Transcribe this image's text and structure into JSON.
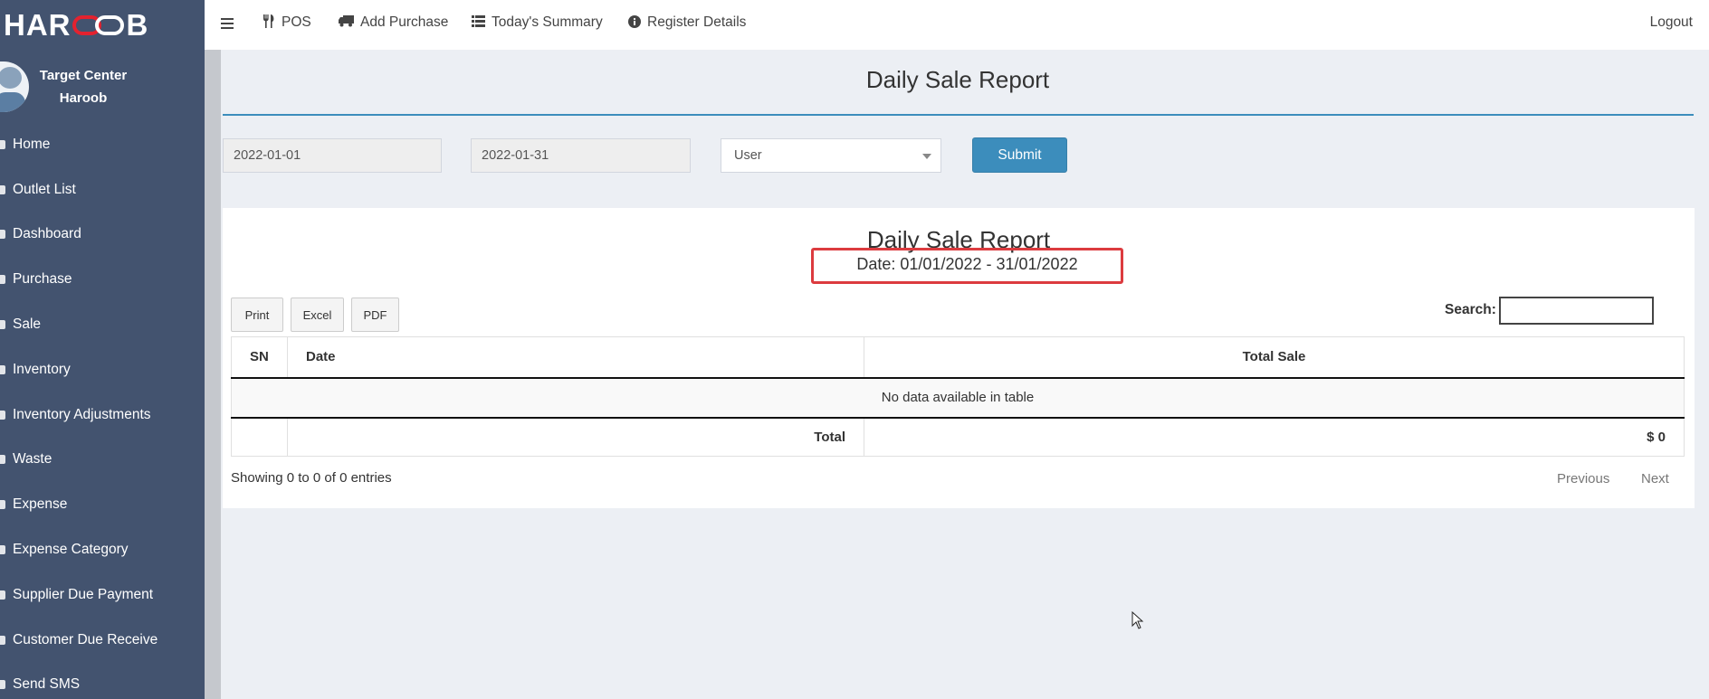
{
  "logo": {
    "text_a": "HAR",
    "text_b": "B"
  },
  "user": {
    "line1": "Target Center",
    "line2": "Haroob"
  },
  "sidebar": {
    "items": [
      {
        "label": "Home",
        "icon": "home-icon"
      },
      {
        "label": "Outlet List",
        "icon": "list-icon"
      },
      {
        "label": "Dashboard",
        "icon": "dashboard-icon"
      },
      {
        "label": "Purchase",
        "icon": "purchase-icon"
      },
      {
        "label": "Sale",
        "icon": "sale-icon"
      },
      {
        "label": "Inventory",
        "icon": "inventory-icon"
      },
      {
        "label": "Inventory Adjustments",
        "icon": "adjustments-icon"
      },
      {
        "label": "Waste",
        "icon": "waste-icon"
      },
      {
        "label": "Expense",
        "icon": "expense-icon"
      },
      {
        "label": "Expense Category",
        "icon": "category-icon"
      },
      {
        "label": "Supplier Due Payment",
        "icon": "supplier-icon"
      },
      {
        "label": "Customer Due Receive",
        "icon": "customer-icon"
      },
      {
        "label": "Send SMS",
        "icon": "sms-icon"
      }
    ]
  },
  "topbar": {
    "pos": "POS",
    "add_purchase": "Add Purchase",
    "todays_summary": "Today's Summary",
    "register_details": "Register Details",
    "logout": "Logout"
  },
  "page": {
    "title": "Daily Sale Report"
  },
  "filters": {
    "start_date": "2022-01-01",
    "end_date": "2022-01-31",
    "user_select": "User",
    "submit": "Submit"
  },
  "report": {
    "title": "Daily Sale Report",
    "date_range": "Date: 01/01/2022 - 31/01/2022",
    "highlight_color": "#dc3b3f"
  },
  "export_buttons": {
    "print": "Print",
    "excel": "Excel",
    "pdf": "PDF"
  },
  "search": {
    "label": "Search:",
    "value": ""
  },
  "table": {
    "headers": {
      "sn": "SN",
      "date": "Date",
      "total_sale": "Total Sale"
    },
    "empty_message": "No data available in table",
    "footer": {
      "label": "Total",
      "value": "$ 0"
    }
  },
  "pagination": {
    "info": "Showing 0 to 0 of 0 entries",
    "previous": "Previous",
    "next": "Next"
  },
  "colors": {
    "sidebar": "#43536f",
    "accent": "#3c8dbc",
    "background": "#eceff4"
  }
}
